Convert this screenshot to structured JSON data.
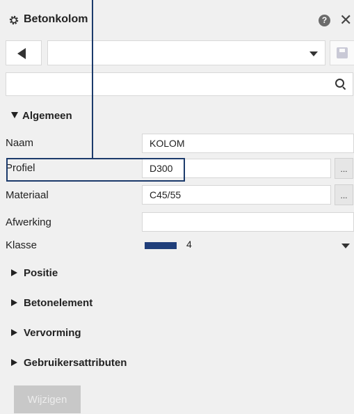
{
  "window": {
    "title": "Betonkolom",
    "help_icon": "question-icon",
    "close_icon": "close-icon",
    "help_text": "?",
    "close_text": "✕"
  },
  "toolbar": {
    "back_icon": "back-arrow-icon",
    "combo_value": "",
    "save_icon": "save-icon"
  },
  "search": {
    "placeholder": "",
    "icon": "search-icon"
  },
  "sections": {
    "algemeen": "Algemeen",
    "positie": "Positie",
    "betonelement": "Betonelement",
    "vervorming": "Vervorming",
    "gebruikersattributen": "Gebruikersattributen"
  },
  "properties": {
    "naam": {
      "label": "Naam",
      "value": "KOLOM"
    },
    "profiel": {
      "label": "Profiel",
      "value": "D300",
      "button": "..."
    },
    "materiaal": {
      "label": "Materiaal",
      "value": "C45/55",
      "button": "..."
    },
    "afwerking": {
      "label": "Afwerking",
      "value": ""
    },
    "klasse": {
      "label": "Klasse",
      "value": "4",
      "swatch_color": "#1f3e7a"
    }
  },
  "actions": {
    "modify_label": "Wijzigen"
  },
  "colors": {
    "callout": "#1b3a6b",
    "panel_bg": "#f0f0f0"
  }
}
